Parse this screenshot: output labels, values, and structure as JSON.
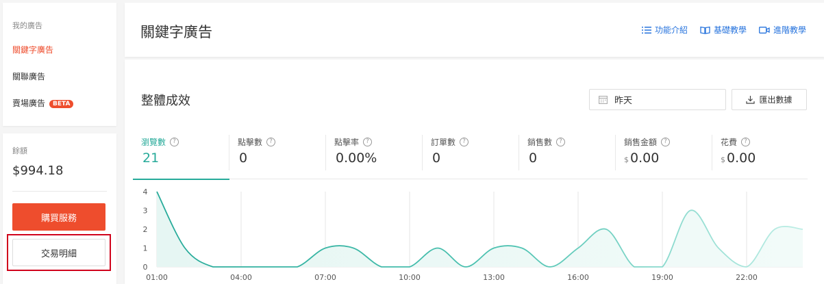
{
  "sidebar": {
    "section_title": "我的廣告",
    "items": [
      {
        "label": "關鍵字廣告",
        "active": true
      },
      {
        "label": "關聯廣告",
        "active": false
      },
      {
        "label": "賣場廣告",
        "active": false,
        "badge": "BETA"
      }
    ],
    "balance_label": "餘額",
    "balance_value": "$994.18",
    "buy_button": "購買服務",
    "transactions_button": "交易明細"
  },
  "header": {
    "title": "關鍵字廣告",
    "links": [
      {
        "label": "功能介紹",
        "icon": "list-icon"
      },
      {
        "label": "基礎教學",
        "icon": "book-icon"
      },
      {
        "label": "進階教學",
        "icon": "video-icon"
      }
    ]
  },
  "performance": {
    "title": "整體成效",
    "date_value": "昨天",
    "export_label": "匯出數據",
    "metrics": [
      {
        "label": "瀏覽數",
        "value": "21",
        "currency": "",
        "active": true
      },
      {
        "label": "點擊數",
        "value": "0",
        "currency": ""
      },
      {
        "label": "點擊率",
        "value": "0.00%",
        "currency": ""
      },
      {
        "label": "訂單數",
        "value": "0",
        "currency": ""
      },
      {
        "label": "銷售數",
        "value": "0",
        "currency": ""
      },
      {
        "label": "銷售金額",
        "value": "0.00",
        "currency": "$"
      },
      {
        "label": "花費",
        "value": "0.00",
        "currency": "$"
      }
    ]
  },
  "colors": {
    "accent": "#ee4d2d",
    "teal": "#26aa99",
    "link": "#2673dd"
  },
  "chart_data": {
    "type": "area",
    "x": [
      "01:00",
      "02:00",
      "03:00",
      "04:00",
      "05:00",
      "06:00",
      "07:00",
      "08:00",
      "09:00",
      "10:00",
      "11:00",
      "12:00",
      "13:00",
      "14:00",
      "15:00",
      "16:00",
      "17:00",
      "18:00",
      "19:00",
      "20:00",
      "21:00",
      "22:00",
      "23:00",
      "24:00"
    ],
    "x_ticks": [
      "01:00",
      "04:00",
      "07:00",
      "10:00",
      "13:00",
      "16:00",
      "19:00",
      "22:00"
    ],
    "series": [
      {
        "values": [
          4,
          1,
          0,
          0,
          0,
          0,
          1,
          1,
          0,
          0,
          1,
          0,
          1,
          1,
          0,
          1,
          2,
          0,
          0,
          3,
          1,
          0,
          2,
          2
        ]
      }
    ],
    "ylim": [
      0,
      4
    ],
    "y_ticks": [
      0,
      1,
      2,
      3,
      4
    ],
    "grid": "vertical"
  }
}
